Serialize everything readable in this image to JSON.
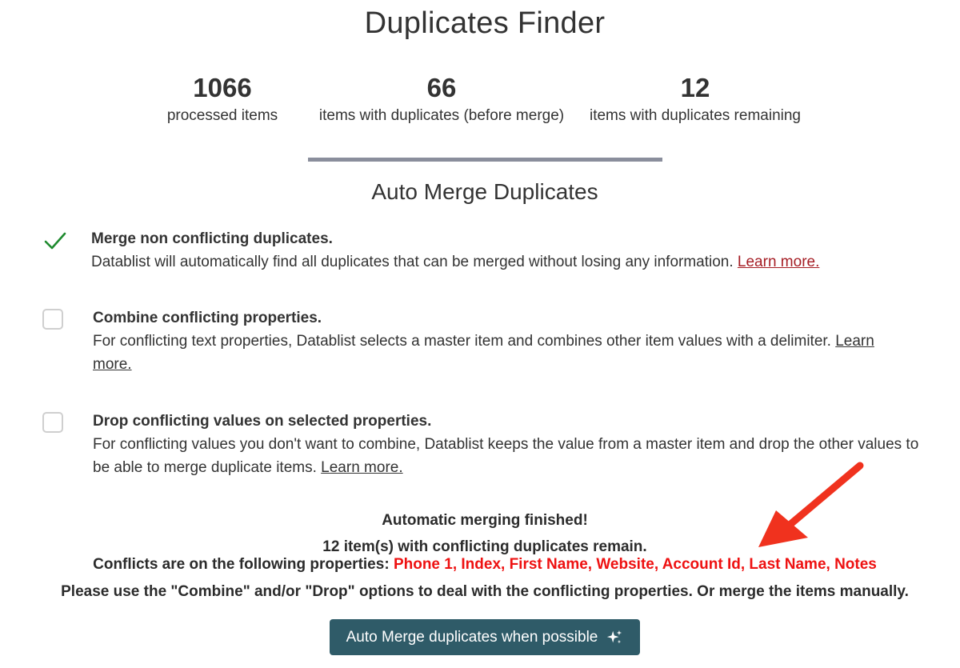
{
  "header": {
    "title": "Duplicates Finder"
  },
  "stats": {
    "processed": {
      "value": "1066",
      "label": "processed items"
    },
    "before_merge": {
      "value": "66",
      "label": "items with duplicates (before merge)"
    },
    "remaining": {
      "value": "12",
      "label": "items with duplicates remaining"
    }
  },
  "section": {
    "title": "Auto Merge Duplicates"
  },
  "options": [
    {
      "title": "Merge non conflicting duplicates.",
      "description": "Datablist will automatically find all duplicates that can be merged without losing any information.",
      "link": "Learn more.",
      "checked": true
    },
    {
      "title": "Combine conflicting properties.",
      "description": "For conflicting text properties, Datablist selects a master item and combines other item values with a delimiter.",
      "link": "Learn more.",
      "checked": false
    },
    {
      "title": "Drop conflicting values on selected properties.",
      "description": "For conflicting values you don't want to combine, Datablist keeps the value from a master item and drop the other values to be able to merge duplicate items.",
      "link": "Learn more.",
      "checked": false
    }
  ],
  "result": {
    "finished": "Automatic merging finished!",
    "remain": "12 item(s) with conflicting duplicates remain.",
    "conflicts_prefix": "Conflicts are on the following properties:",
    "conflict_properties": "Phone 1, Index, First Name, Website, Account Id, Last Name, Notes",
    "please": "Please use the \"Combine\" and/or \"Drop\" options to deal with the conflicting properties. Or merge the items manually."
  },
  "action": {
    "button_label": "Auto Merge duplicates when possible",
    "button_icon": "sparkles-icon"
  },
  "colors": {
    "button_bg": "#2f5b68",
    "conflict_red": "#ee1111",
    "check_green": "#1e8a2e",
    "arrow_red": "#f0321e"
  },
  "icons": {
    "check": "check-icon",
    "arrow": "arrow-icon"
  }
}
